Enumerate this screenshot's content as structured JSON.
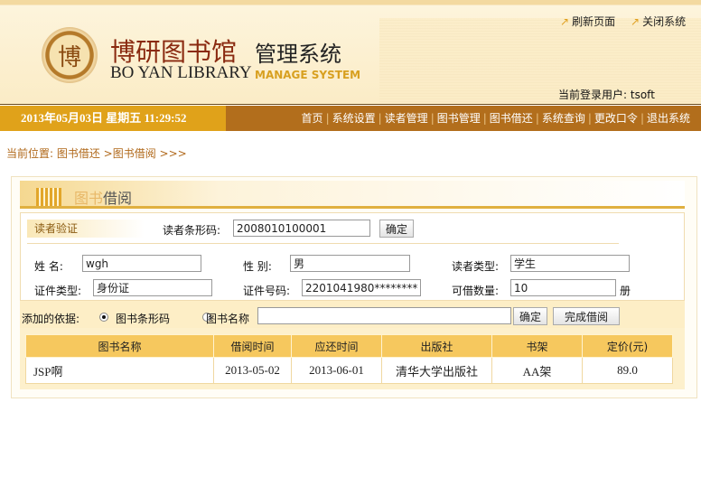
{
  "header": {
    "title_cn": "博研图书馆",
    "title_cn2": "管理系统",
    "title_en": "BO YAN LIBRARY",
    "title_en2": "MANAGE SYSTEM",
    "logo_text": "博",
    "refresh": "刷新页面",
    "close": "关闭系统",
    "user_label": "当前登录用户:",
    "user": "tsoft"
  },
  "nav": {
    "datetime": "2013年05月03日  星期五  11:29:52",
    "items": [
      "首页",
      "系统设置",
      "读者管理",
      "图书管理",
      "图书借还",
      "系统查询",
      "更改口令",
      "退出系统"
    ]
  },
  "breadcrumb": "当前位置: 图书借还 >图书借阅 >>>",
  "panel": {
    "title_faded": "图书",
    "title": "借阅"
  },
  "reader": {
    "verify": "读者验证",
    "barcode_label": "读者条形码:",
    "barcode": "2008010100001",
    "confirm": "确定",
    "name_label": "姓  名:",
    "name": "wgh",
    "gender_label": "性  别:",
    "gender": "男",
    "type_label": "读者类型:",
    "type": "学生",
    "id_type_label": "证件类型:",
    "id_type": "身份证",
    "id_no_label": "证件号码:",
    "id_no": "2201041980********",
    "quota_label": "可借数量:",
    "quota": "10",
    "quota_unit": "册"
  },
  "add": {
    "label": "添加的依据:",
    "opt1": "图书条形码",
    "opt2": "图书名称",
    "value": "",
    "confirm": "确定",
    "finish": "完成借阅"
  },
  "table": {
    "headers": [
      "图书名称",
      "借阅时间",
      "应还时间",
      "出版社",
      "书架",
      "定价(元)"
    ],
    "rows": [
      [
        "JSP啊",
        "2013-05-02",
        "2013-06-01",
        "清华大学出版社",
        "AA架",
        "89.0"
      ]
    ]
  }
}
